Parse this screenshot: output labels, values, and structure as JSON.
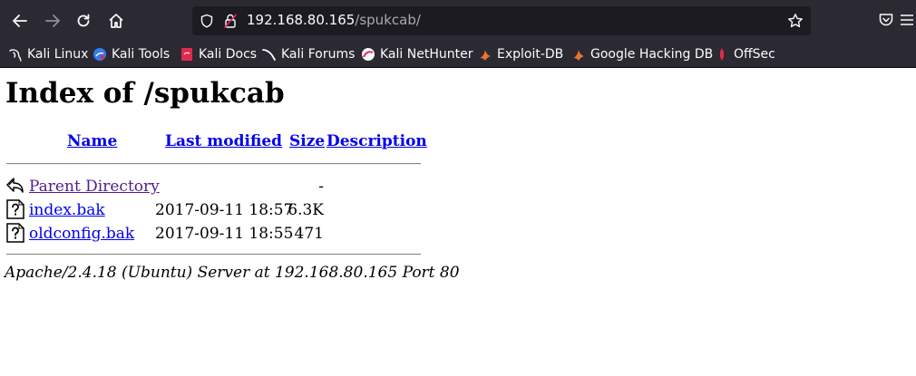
{
  "browser": {
    "url_host": "192.168.80.165",
    "url_path": "/spukcab/",
    "bookmarks": [
      {
        "label": "Kali Linux",
        "icon": "kali-dragon-icon"
      },
      {
        "label": "Kali Tools",
        "icon": "kali-tools-icon"
      },
      {
        "label": "Kali Docs",
        "icon": "kali-docs-icon"
      },
      {
        "label": "Kali Forums",
        "icon": "kali-forums-icon"
      },
      {
        "label": "Kali NetHunter",
        "icon": "nethunter-icon"
      },
      {
        "label": "Exploit-DB",
        "icon": "exploit-db-icon"
      },
      {
        "label": "Google Hacking DB",
        "icon": "ghdb-icon"
      },
      {
        "label": "OffSec",
        "icon": "offsec-icon"
      }
    ]
  },
  "page": {
    "title": "Index of /spukcab",
    "columns": {
      "name": "Name",
      "last_modified": "Last modified",
      "size": "Size",
      "description": "Description"
    },
    "parent": {
      "name": "Parent Directory",
      "size": "-"
    },
    "files": [
      {
        "name": "index.bak",
        "modified": "2017-09-11 18:57",
        "size": "6.3K"
      },
      {
        "name": "oldconfig.bak",
        "modified": "2017-09-11 18:55",
        "size": "471"
      }
    ],
    "address": "Apache/2.4.18 (Ubuntu) Server at 192.168.80.165 Port 80"
  }
}
